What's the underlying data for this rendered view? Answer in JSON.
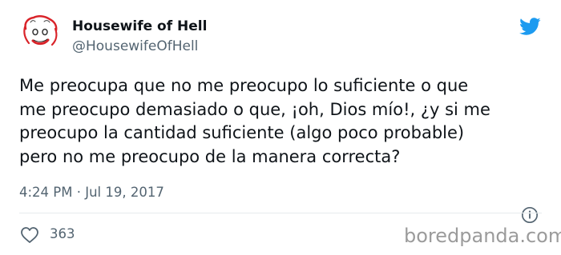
{
  "tweet": {
    "display_name": "Housewife of Hell",
    "handle": "@HousewifeOfHell",
    "text": "Me preocupa que no me preocupo lo suficiente o que\nme preocupo demasiado o que, ¡oh, Dios mío!, ¿y si me\npreocupo la cantidad suficiente (algo poco probable)\npero no me preocupo de la manera correcta?",
    "timestamp": "4:24 PM · Jul 19, 2017",
    "like_count": "363"
  },
  "watermark": {
    "text": "boredpanda.com"
  },
  "colors": {
    "twitter_blue": "#1d9bf0",
    "muted_text": "#536471",
    "primary_text": "#0f1419",
    "avatar_accent": "#d9242a"
  },
  "icons": {
    "brand": "twitter-bird-icon",
    "info": "info-icon",
    "like": "heart-icon"
  }
}
